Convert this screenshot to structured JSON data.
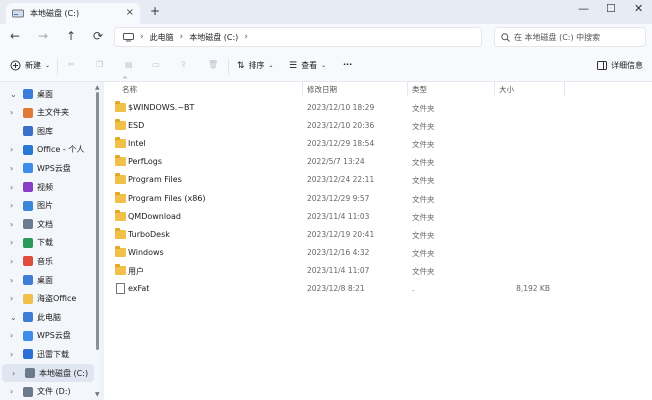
{
  "tab": {
    "title": "本地磁盘 (C:)",
    "close": "×",
    "new_tab": "+"
  },
  "window": {
    "minimize": "—",
    "maximize": "☐",
    "close": "✕"
  },
  "nav": {
    "back": "←",
    "forward": "→",
    "up": "↑",
    "refresh": "⟳",
    "breadcrumb": [
      "此电脑",
      "本地磁盘 (C:)"
    ],
    "search_placeholder": "在 本地磁盘 (C:) 中搜索"
  },
  "toolbar": {
    "new_label": "新建",
    "sort_label": "排序",
    "view_label": "查看",
    "more_label": "···",
    "details_label": "详细信息"
  },
  "columns": {
    "name": "名称",
    "date": "修改日期",
    "type": "类型",
    "size": "大小"
  },
  "files": [
    {
      "name": "$WINDOWS.~BT",
      "date": "2023/12/10 18:29",
      "type": "文件夹",
      "size": "",
      "kind": "folder"
    },
    {
      "name": "ESD",
      "date": "2023/12/10 20:36",
      "type": "文件夹",
      "size": "",
      "kind": "folder"
    },
    {
      "name": "Intel",
      "date": "2023/12/29 18:54",
      "type": "文件夹",
      "size": "",
      "kind": "folder"
    },
    {
      "name": "PerfLogs",
      "date": "2022/5/7 13:24",
      "type": "文件夹",
      "size": "",
      "kind": "folder"
    },
    {
      "name": "Program Files",
      "date": "2023/12/24 22:11",
      "type": "文件夹",
      "size": "",
      "kind": "folder"
    },
    {
      "name": "Program Files (x86)",
      "date": "2023/12/29 9:57",
      "type": "文件夹",
      "size": "",
      "kind": "folder"
    },
    {
      "name": "QMDownload",
      "date": "2023/11/4 11:03",
      "type": "文件夹",
      "size": "",
      "kind": "folder"
    },
    {
      "name": "TurboDesk",
      "date": "2023/12/19 20:41",
      "type": "文件夹",
      "size": "",
      "kind": "folder"
    },
    {
      "name": "Windows",
      "date": "2023/12/16 4:32",
      "type": "文件夹",
      "size": "",
      "kind": "folder"
    },
    {
      "name": "用户",
      "date": "2023/11/4 11:07",
      "type": "文件夹",
      "size": "",
      "kind": "folder"
    },
    {
      "name": "exFat",
      "date": "2023/12/8 8:21",
      "type": ".",
      "size": "8,192 KB",
      "kind": "file"
    }
  ],
  "sidebar": [
    {
      "label": "桌面",
      "chevron": "⌄",
      "icon_color": "#3b7dd8",
      "icon": "desktop-icon"
    },
    {
      "label": "主文件夹",
      "chevron": "›",
      "icon_color": "#e07a3b",
      "icon": "home-icon"
    },
    {
      "label": "图库",
      "chevron": "",
      "icon_color": "#3a6fc9",
      "icon": "gallery-icon"
    },
    {
      "label": "Office - 个人",
      "chevron": "›",
      "icon_color": "#2a78d6",
      "icon": "onedrive-icon"
    },
    {
      "label": "WPS云盘",
      "chevron": "›",
      "icon_color": "#3d8de8",
      "icon": "cloud-icon"
    },
    {
      "label": "视频",
      "chevron": "›",
      "icon_color": "#8a3cc9",
      "icon": "video-icon"
    },
    {
      "label": "图片",
      "chevron": "›",
      "icon_color": "#3b86d8",
      "icon": "pictures-icon"
    },
    {
      "label": "文档",
      "chevron": "›",
      "icon_color": "#6b7b90",
      "icon": "documents-icon"
    },
    {
      "label": "下载",
      "chevron": "›",
      "icon_color": "#2a9a5a",
      "icon": "download-icon"
    },
    {
      "label": "音乐",
      "chevron": "›",
      "icon_color": "#e04b3b",
      "icon": "music-icon"
    },
    {
      "label": "桌面",
      "chevron": "›",
      "icon_color": "#3b7dd8",
      "icon": "desktop-icon"
    },
    {
      "label": "海盗Office",
      "chevron": "›",
      "icon_color": "#f0c048",
      "icon": "folder-icon"
    },
    {
      "label": "此电脑",
      "chevron": "⌄",
      "icon_color": "#3b7dd8",
      "icon": "computer-icon"
    },
    {
      "label": "WPS云盘",
      "chevron": "›",
      "icon_color": "#3d8de8",
      "icon": "cloud-icon"
    },
    {
      "label": "迅雷下载",
      "chevron": "›",
      "icon_color": "#2e6fd6",
      "icon": "thunder-icon"
    },
    {
      "label": "本地磁盘 (C:)",
      "chevron": "›",
      "icon_color": "#6d7a8c",
      "icon": "drive-icon",
      "selected": true
    },
    {
      "label": "文件 (D:)",
      "chevron": "›",
      "icon_color": "#6d7a8c",
      "icon": "drive-icon"
    }
  ],
  "colors": {
    "accent": "#3b7dd8",
    "folder": "#f0c048",
    "selected": "#dfe6f2"
  }
}
